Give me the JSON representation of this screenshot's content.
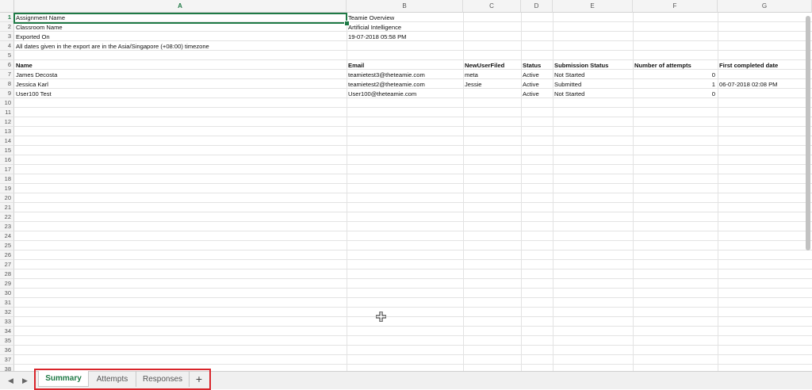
{
  "columns": [
    "A",
    "B",
    "C",
    "D",
    "E",
    "F",
    "G"
  ],
  "active_column": "A",
  "row_numbers": [
    "1",
    "2",
    "3",
    "4",
    "5",
    "6",
    "7",
    "8",
    "9",
    "10",
    "11",
    "12",
    "13",
    "14",
    "15",
    "16",
    "17",
    "18",
    "19",
    "20",
    "21",
    "22",
    "23",
    "24",
    "25",
    "26",
    "27",
    "28",
    "29",
    "30",
    "31",
    "32",
    "33",
    "34",
    "35",
    "36",
    "37",
    "38"
  ],
  "info": {
    "assignment_name_label": "Assignment Name",
    "assignment_name_value": "Teamie Overview",
    "classroom_name_label": "Classroom Name",
    "classroom_name_value": "Artificial Intelligence",
    "exported_on_label": "Exported On",
    "exported_on_value": "19-07-2018 05:58 PM",
    "timezone_note": "All dates given in the export are in the Asia/Singapore (+08:00) timezone"
  },
  "table": {
    "headers": [
      "Name",
      "Email",
      "NewUserFiled",
      "Status",
      "Submission Status",
      "Number of attempts",
      "First completed date"
    ],
    "rows": [
      [
        "James Decosta",
        "teamietest3@theteamie.com",
        "meta",
        "Active",
        "Not Started",
        "0",
        ""
      ],
      [
        "Jessica Karl",
        "teamietest2@theteamie.com",
        "Jessie",
        "Active",
        "Submitted",
        "1",
        "06-07-2018 02:08 PM"
      ],
      [
        "User100 Test",
        "User100@theteamie.com",
        "",
        "Active",
        "Not Started",
        "0",
        ""
      ]
    ]
  },
  "sheet_tabs": {
    "nav_prev": "◀",
    "nav_next": "▶",
    "tabs": [
      "Summary",
      "Attempts",
      "Responses"
    ],
    "active_tab": "Summary",
    "add_label": "+"
  },
  "colors": {
    "accent": "#1f7a46",
    "highlight_box": "#d9252b"
  }
}
